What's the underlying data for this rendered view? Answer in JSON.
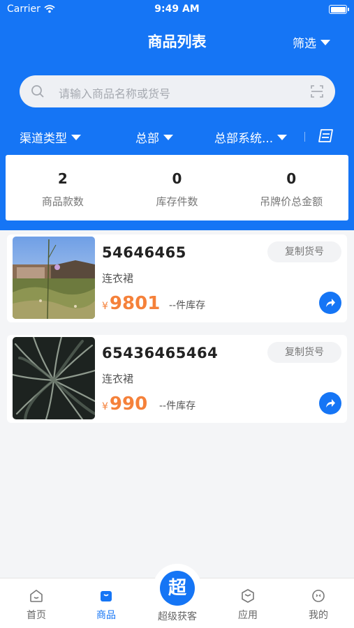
{
  "status_bar": {
    "carrier": "Carrier",
    "time": "9:49 AM"
  },
  "header": {
    "title": "商品列表",
    "filter_label": "筛选"
  },
  "search": {
    "placeholder": "请输入商品名称或货号"
  },
  "filters": {
    "channel": "渠道类型",
    "hq": "总部",
    "system": "总部系统..."
  },
  "stats": [
    {
      "value": "2",
      "label": "商品款数"
    },
    {
      "value": "0",
      "label": "库存件数"
    },
    {
      "value": "0",
      "label": "吊牌价总金额"
    }
  ],
  "products": [
    {
      "code": "54646465",
      "category": "连衣裙",
      "currency": "¥",
      "price": "9801",
      "stock": "--件库存",
      "copy_label": "复制货号"
    },
    {
      "code": "65436465464",
      "category": "连衣裙",
      "currency": "¥",
      "price": "990",
      "stock": "--件库存",
      "copy_label": "复制货号"
    }
  ],
  "tabbar": {
    "home": "首页",
    "products": "商品",
    "center_badge": "超",
    "center": "超级获客",
    "apps": "应用",
    "mine": "我的"
  },
  "colors": {
    "primary": "#1575f5",
    "price": "#f5813a",
    "background": "#f4f5f7"
  }
}
